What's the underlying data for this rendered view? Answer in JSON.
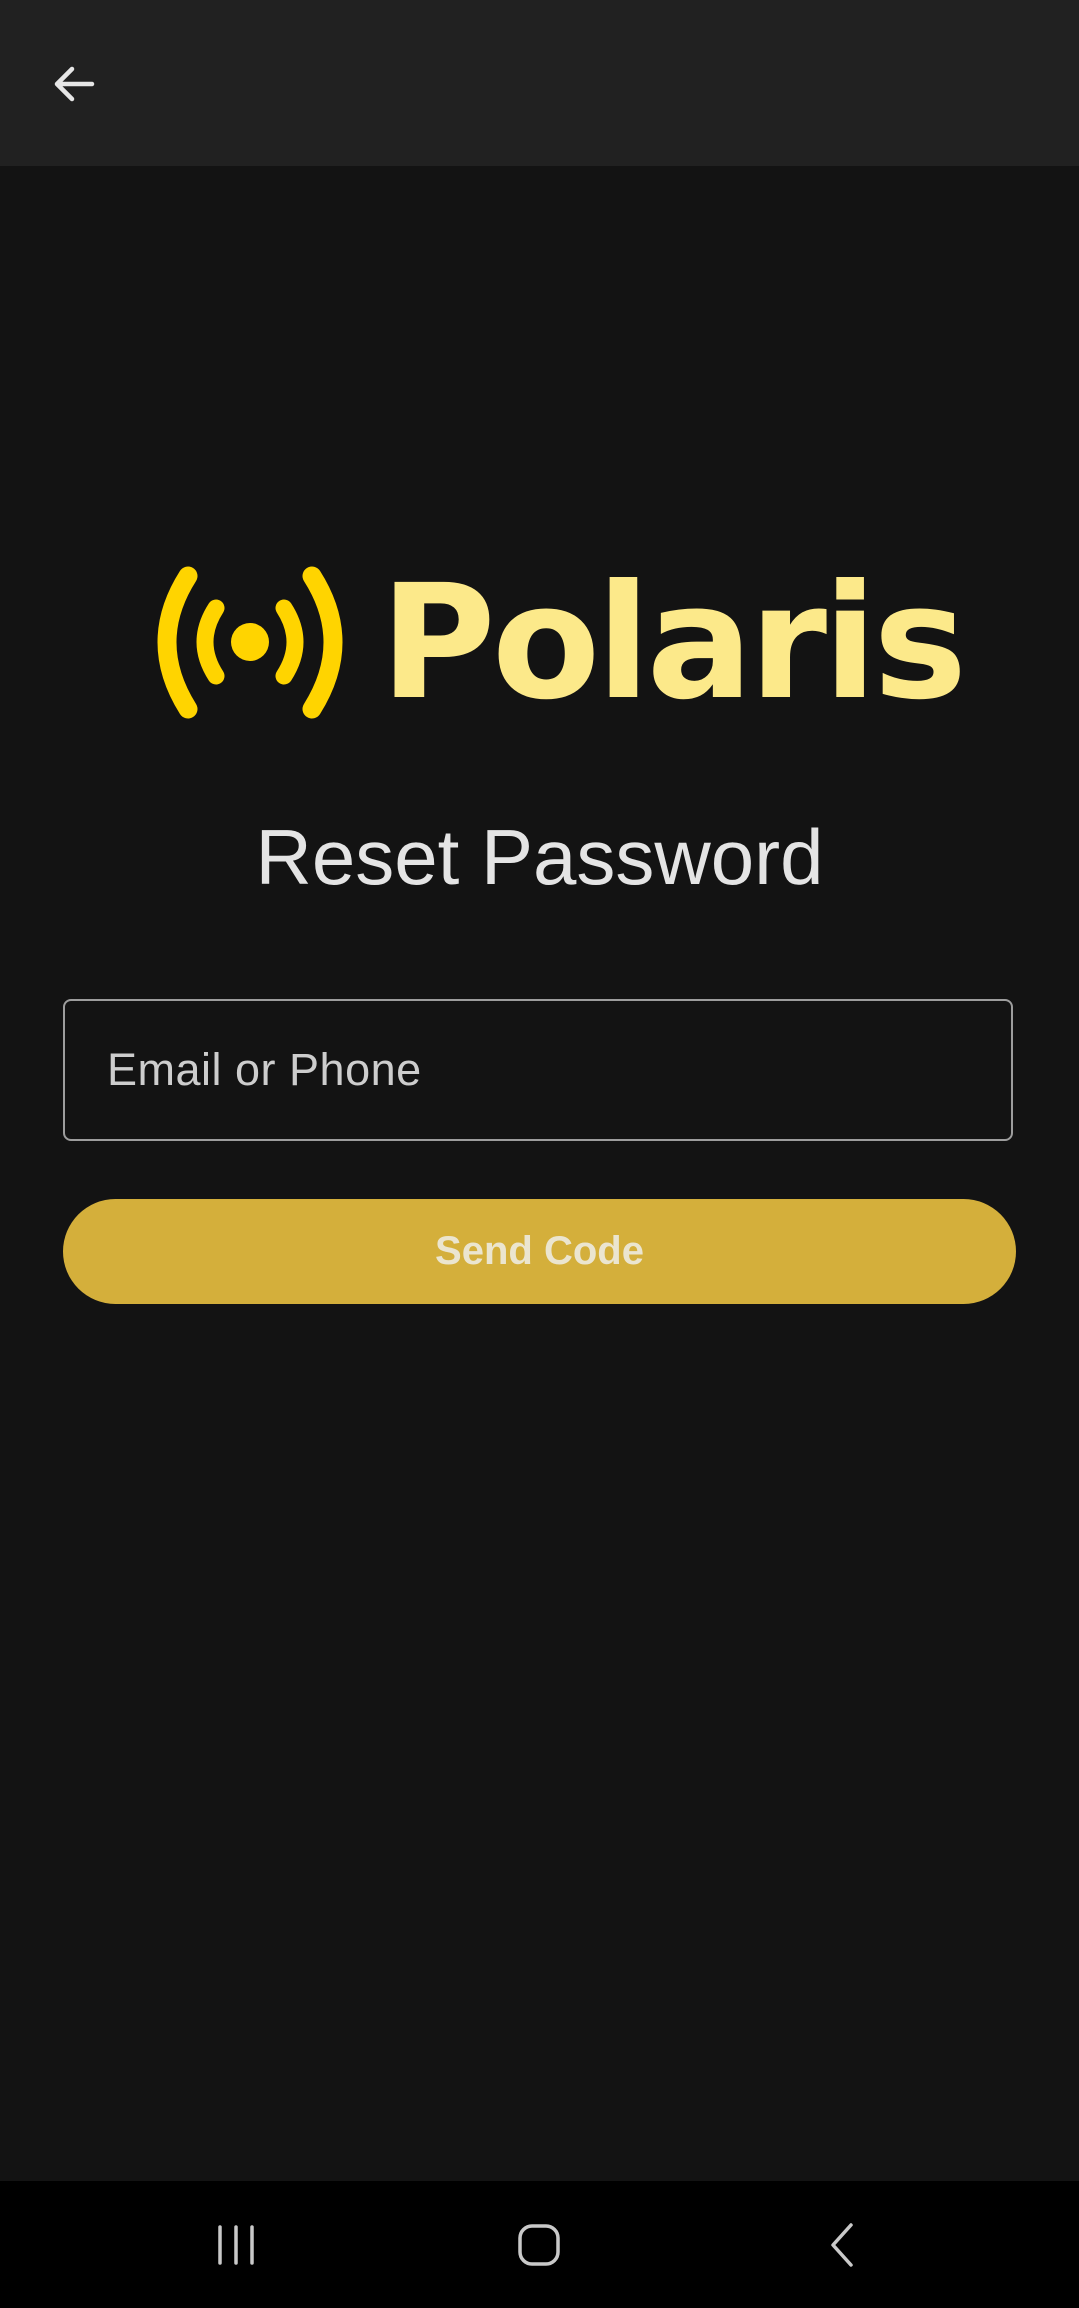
{
  "app_bar": {
    "back_icon": "arrow-left-icon"
  },
  "logo": {
    "icon": "broadcast-signal-icon",
    "wordmark": "Polaris",
    "icon_color": "#ffd400",
    "wordmark_color": "#fce98a"
  },
  "page": {
    "title": "Reset Password"
  },
  "form": {
    "contact_placeholder": "Email or Phone",
    "contact_value": "",
    "submit_label": "Send Code"
  },
  "system_nav": {
    "recents_icon": "recents-icon",
    "home_icon": "home-icon",
    "back_icon": "back-chevron-icon"
  },
  "colors": {
    "background": "#131313",
    "app_bar": "#212121",
    "accent": "#d4af3b",
    "nav_bar": "#000000"
  }
}
